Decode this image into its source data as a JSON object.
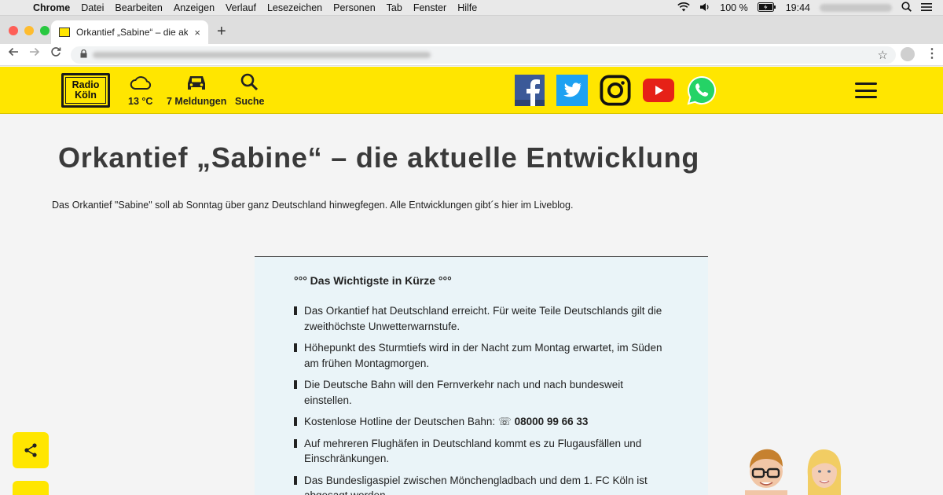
{
  "menubar": {
    "app": "Chrome",
    "items": [
      "Datei",
      "Bearbeiten",
      "Anzeigen",
      "Verlauf",
      "Lesezeichen",
      "Personen",
      "Tab",
      "Fenster",
      "Hilfe"
    ],
    "battery": "100 %",
    "time": "19:44"
  },
  "browser": {
    "tab_title": "Orkantief „Sabine“ – die aktuelle",
    "tab_close": "×",
    "new_tab": "+"
  },
  "header": {
    "logo_line1": "Radio",
    "logo_line2": "Köln",
    "weather": "13 °C",
    "traffic": "7 Meldungen",
    "search": "Suche"
  },
  "colors": {
    "brand_yellow": "#ffe600",
    "facebook": "#3b5998",
    "twitter": "#1da1f2",
    "youtube": "#e62117",
    "whatsapp": "#25d366",
    "box_bg": "#eaf4f8"
  },
  "article": {
    "title": "Orkantief „Sabine“ – die aktuelle Entwicklung",
    "intro": "Das Orkantief \"Sabine\" soll ab Sonntag über ganz Deutschland hinwegfegen. Alle Entwicklungen gibt´s hier im Liveblog.",
    "box_heading": "°°° Das Wichtigste in Kürze °°°",
    "bullets": [
      "Das Orkantief hat Deutschland erreicht. Für weite Teile Deutschlands gilt die zweithöchste Unwetterwarnstufe.",
      "Höhepunkt des Sturmtiefs wird in der Nacht zum Montag erwartet, im Süden am frühen Montagmorgen.",
      "Die Deutsche Bahn will den Fernverkehr nach und nach bundesweit einstellen.",
      "Kostenlose Hotline der Deutschen Bahn: ☏",
      "Auf mehreren Flughäfen in Deutschland kommt es zu Flugausfällen und Einschränkungen.",
      "Das Bundesligaspiel zwischen Mönchengladbach und dem 1. FC Köln ist abgesagt worden."
    ],
    "hotline_number": "08000 99 66 33"
  }
}
